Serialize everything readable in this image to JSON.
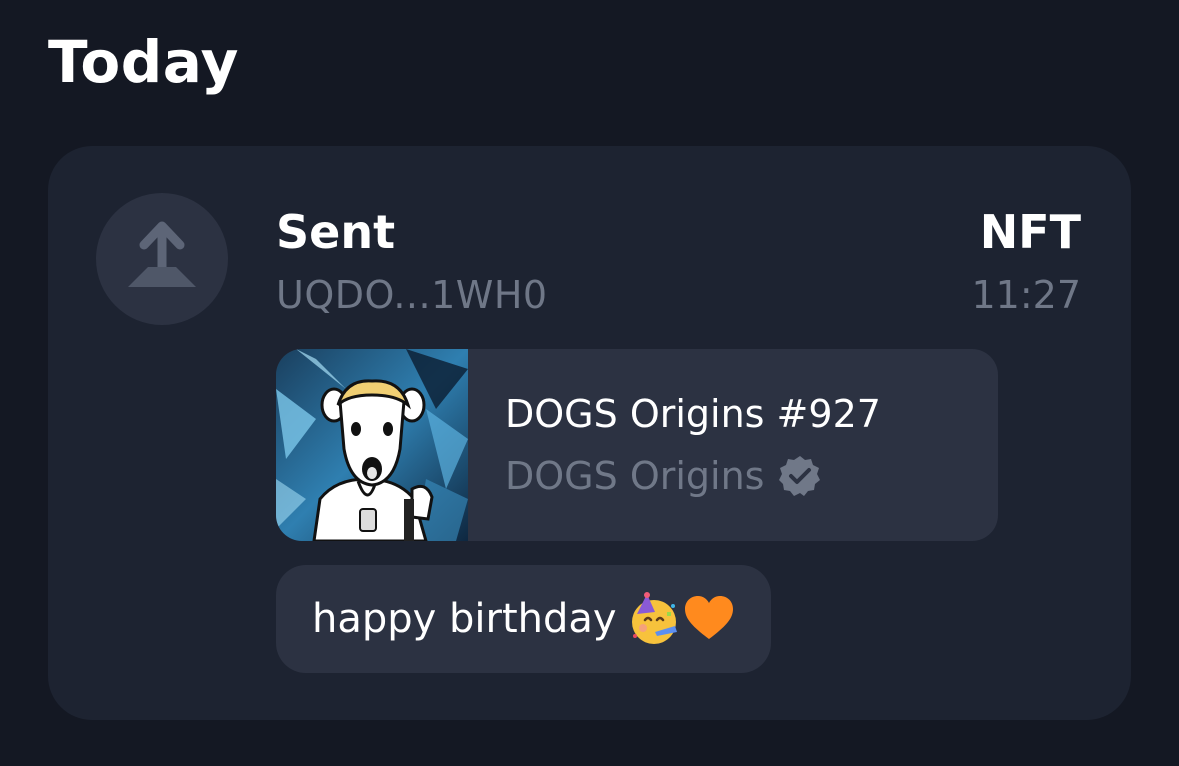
{
  "section": {
    "title": "Today"
  },
  "transaction": {
    "title": "Sent",
    "address": "UQDO...1WH0",
    "kind": "NFT",
    "time": "11:27",
    "icon": "arrow-up-icon",
    "nft": {
      "name": "DOGS Origins #927",
      "collection": "DOGS Origins",
      "verified_icon": "verified-badge-icon"
    },
    "comment": {
      "text": "happy birthday",
      "emojis": [
        "partying-face-emoji",
        "orange-heart-emoji"
      ]
    }
  },
  "colors": {
    "background": "#141823",
    "card": "#1d2331",
    "inner": "#2c3242",
    "secondary_text": "#6f7787"
  }
}
